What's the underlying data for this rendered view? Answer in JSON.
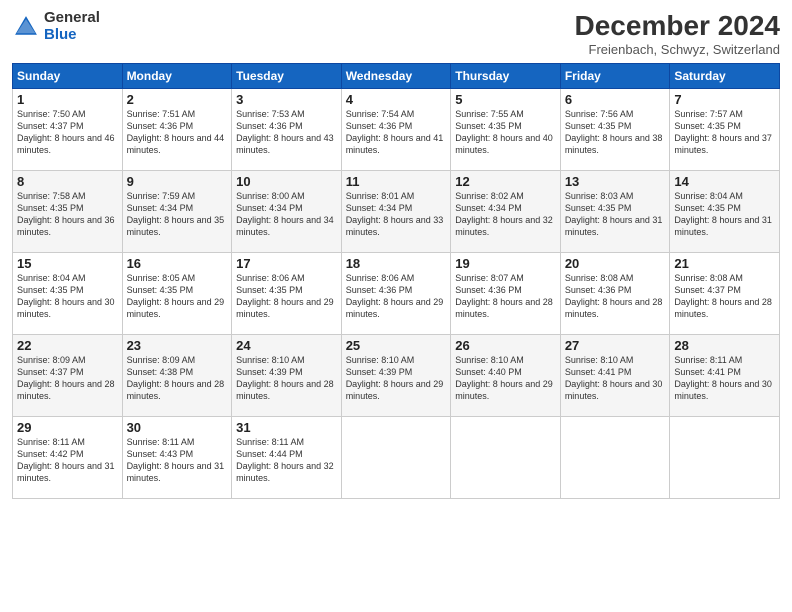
{
  "logo": {
    "general": "General",
    "blue": "Blue"
  },
  "title": "December 2024",
  "location": "Freienbach, Schwyz, Switzerland",
  "headers": [
    "Sunday",
    "Monday",
    "Tuesday",
    "Wednesday",
    "Thursday",
    "Friday",
    "Saturday"
  ],
  "weeks": [
    [
      {
        "day": "1",
        "sunrise": "7:50 AM",
        "sunset": "4:37 PM",
        "daylight": "8 hours and 46 minutes."
      },
      {
        "day": "2",
        "sunrise": "7:51 AM",
        "sunset": "4:36 PM",
        "daylight": "8 hours and 44 minutes."
      },
      {
        "day": "3",
        "sunrise": "7:53 AM",
        "sunset": "4:36 PM",
        "daylight": "8 hours and 43 minutes."
      },
      {
        "day": "4",
        "sunrise": "7:54 AM",
        "sunset": "4:36 PM",
        "daylight": "8 hours and 41 minutes."
      },
      {
        "day": "5",
        "sunrise": "7:55 AM",
        "sunset": "4:35 PM",
        "daylight": "8 hours and 40 minutes."
      },
      {
        "day": "6",
        "sunrise": "7:56 AM",
        "sunset": "4:35 PM",
        "daylight": "8 hours and 38 minutes."
      },
      {
        "day": "7",
        "sunrise": "7:57 AM",
        "sunset": "4:35 PM",
        "daylight": "8 hours and 37 minutes."
      }
    ],
    [
      {
        "day": "8",
        "sunrise": "7:58 AM",
        "sunset": "4:35 PM",
        "daylight": "8 hours and 36 minutes."
      },
      {
        "day": "9",
        "sunrise": "7:59 AM",
        "sunset": "4:34 PM",
        "daylight": "8 hours and 35 minutes."
      },
      {
        "day": "10",
        "sunrise": "8:00 AM",
        "sunset": "4:34 PM",
        "daylight": "8 hours and 34 minutes."
      },
      {
        "day": "11",
        "sunrise": "8:01 AM",
        "sunset": "4:34 PM",
        "daylight": "8 hours and 33 minutes."
      },
      {
        "day": "12",
        "sunrise": "8:02 AM",
        "sunset": "4:34 PM",
        "daylight": "8 hours and 32 minutes."
      },
      {
        "day": "13",
        "sunrise": "8:03 AM",
        "sunset": "4:35 PM",
        "daylight": "8 hours and 31 minutes."
      },
      {
        "day": "14",
        "sunrise": "8:04 AM",
        "sunset": "4:35 PM",
        "daylight": "8 hours and 31 minutes."
      }
    ],
    [
      {
        "day": "15",
        "sunrise": "8:04 AM",
        "sunset": "4:35 PM",
        "daylight": "8 hours and 30 minutes."
      },
      {
        "day": "16",
        "sunrise": "8:05 AM",
        "sunset": "4:35 PM",
        "daylight": "8 hours and 29 minutes."
      },
      {
        "day": "17",
        "sunrise": "8:06 AM",
        "sunset": "4:35 PM",
        "daylight": "8 hours and 29 minutes."
      },
      {
        "day": "18",
        "sunrise": "8:06 AM",
        "sunset": "4:36 PM",
        "daylight": "8 hours and 29 minutes."
      },
      {
        "day": "19",
        "sunrise": "8:07 AM",
        "sunset": "4:36 PM",
        "daylight": "8 hours and 28 minutes."
      },
      {
        "day": "20",
        "sunrise": "8:08 AM",
        "sunset": "4:36 PM",
        "daylight": "8 hours and 28 minutes."
      },
      {
        "day": "21",
        "sunrise": "8:08 AM",
        "sunset": "4:37 PM",
        "daylight": "8 hours and 28 minutes."
      }
    ],
    [
      {
        "day": "22",
        "sunrise": "8:09 AM",
        "sunset": "4:37 PM",
        "daylight": "8 hours and 28 minutes."
      },
      {
        "day": "23",
        "sunrise": "8:09 AM",
        "sunset": "4:38 PM",
        "daylight": "8 hours and 28 minutes."
      },
      {
        "day": "24",
        "sunrise": "8:10 AM",
        "sunset": "4:39 PM",
        "daylight": "8 hours and 28 minutes."
      },
      {
        "day": "25",
        "sunrise": "8:10 AM",
        "sunset": "4:39 PM",
        "daylight": "8 hours and 29 minutes."
      },
      {
        "day": "26",
        "sunrise": "8:10 AM",
        "sunset": "4:40 PM",
        "daylight": "8 hours and 29 minutes."
      },
      {
        "day": "27",
        "sunrise": "8:10 AM",
        "sunset": "4:41 PM",
        "daylight": "8 hours and 30 minutes."
      },
      {
        "day": "28",
        "sunrise": "8:11 AM",
        "sunset": "4:41 PM",
        "daylight": "8 hours and 30 minutes."
      }
    ],
    [
      {
        "day": "29",
        "sunrise": "8:11 AM",
        "sunset": "4:42 PM",
        "daylight": "8 hours and 31 minutes."
      },
      {
        "day": "30",
        "sunrise": "8:11 AM",
        "sunset": "4:43 PM",
        "daylight": "8 hours and 31 minutes."
      },
      {
        "day": "31",
        "sunrise": "8:11 AM",
        "sunset": "4:44 PM",
        "daylight": "8 hours and 32 minutes."
      },
      null,
      null,
      null,
      null
    ]
  ],
  "labels": {
    "sunrise": "Sunrise:",
    "sunset": "Sunset:",
    "daylight": "Daylight:"
  }
}
